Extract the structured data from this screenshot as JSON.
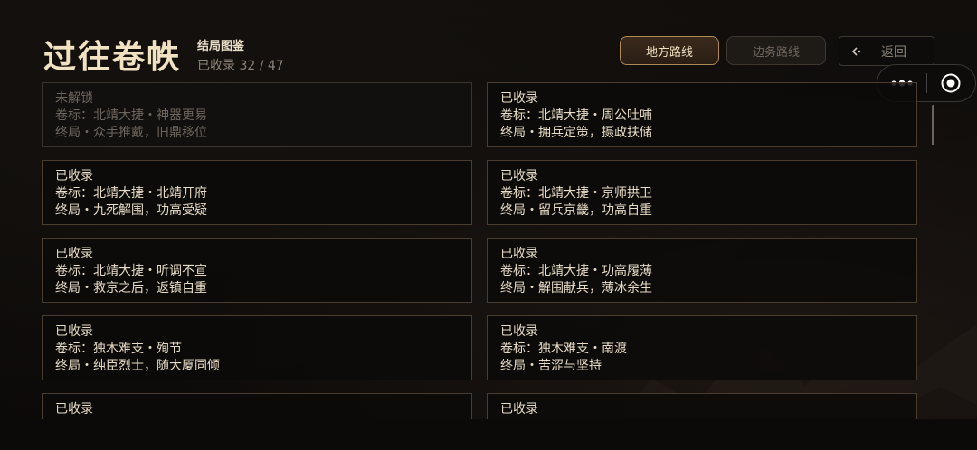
{
  "header": {
    "title": "过往卷帙",
    "subtitle": "结局图鉴",
    "collected": "已收录 32 / 47"
  },
  "routes": {
    "active_label": "地方路线",
    "inactive_label": "边务路线"
  },
  "back": {
    "label": "返回"
  },
  "cards": [
    {
      "status": "未解锁",
      "line1": "卷标：北靖大捷・神器更易",
      "line2": "终局・众手推戴，旧鼎移位",
      "locked": true
    },
    {
      "status": "已收录",
      "line1": "卷标：北靖大捷・周公吐哺",
      "line2": "终局・拥兵定策，摄政扶储",
      "locked": false
    },
    {
      "status": "已收录",
      "line1": "卷标：北靖大捷・北靖开府",
      "line2": "终局・九死解围，功高受疑",
      "locked": false
    },
    {
      "status": "已收录",
      "line1": "卷标：北靖大捷・京师拱卫",
      "line2": "终局・留兵京畿，功高自重",
      "locked": false
    },
    {
      "status": "已收录",
      "line1": "卷标：北靖大捷・听调不宣",
      "line2": "终局・救京之后，返镇自重",
      "locked": false
    },
    {
      "status": "已收录",
      "line1": "卷标：北靖大捷・功高履薄",
      "line2": "终局・解围献兵，薄冰余生",
      "locked": false
    },
    {
      "status": "已收录",
      "line1": "卷标：独木难支・殉节",
      "line2": "终局・纯臣烈士，随大厦同倾",
      "locked": false
    },
    {
      "status": "已收录",
      "line1": "卷标：独木难支・南渡",
      "line2": "终局・苦涩与坚持",
      "locked": false
    },
    {
      "status": "已收录",
      "line1": "",
      "line2": "",
      "locked": false
    },
    {
      "status": "已收录",
      "line1": "",
      "line2": "",
      "locked": false
    }
  ],
  "colors": {
    "accent": "#b08a55",
    "text": "#e8dcc6",
    "muted": "#6e665c",
    "title": "#f1e2c2"
  }
}
